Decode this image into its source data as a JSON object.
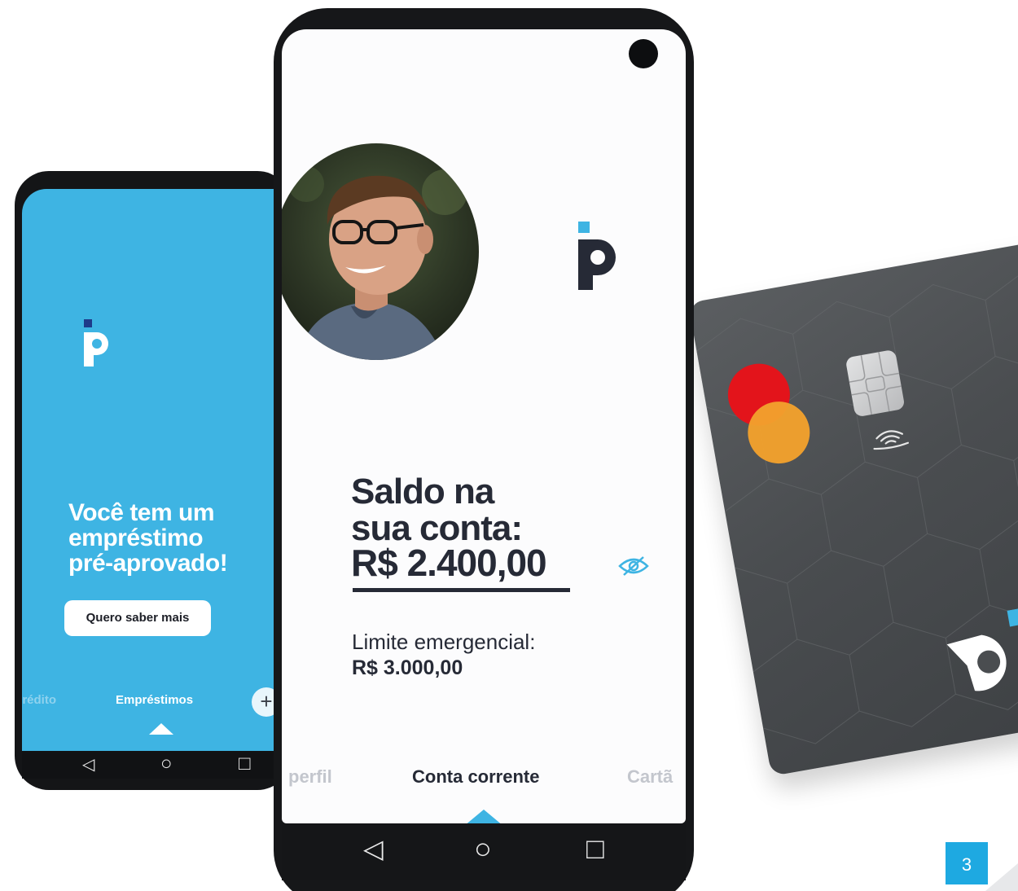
{
  "colors": {
    "brand_blue": "#3eb4e3",
    "dark_text": "#262a36",
    "card_gray": "#4a4d50",
    "mc_red": "#e3141b",
    "mc_yellow": "#f3a12d",
    "badge_blue": "#1ea9e1"
  },
  "left_phone": {
    "headline_line1": "Você tem um",
    "headline_line2": "empréstimo",
    "headline_line3": "pré-aprovado!",
    "cta_label": "Quero saber mais",
    "tabs": [
      {
        "label": "crédito"
      },
      {
        "label": "Empréstimos",
        "active": true
      }
    ],
    "add_symbol": "+",
    "nav": {
      "back": "◁",
      "home": "○",
      "recents": "□"
    }
  },
  "center_phone": {
    "balance_title_line1": "Saldo na",
    "balance_title_line2": "sua conta:",
    "balance_value": "R$ 2.400,00",
    "limit_label": "Limite emergencial:",
    "limit_value": "R$ 3.000,00",
    "tabs": [
      {
        "label": "perfil"
      },
      {
        "label": "Conta corrente",
        "active": true
      },
      {
        "label": "Cartã"
      }
    ],
    "nav": {
      "back": "◁",
      "home": "○",
      "recents": "□"
    }
  },
  "page_number": "3"
}
